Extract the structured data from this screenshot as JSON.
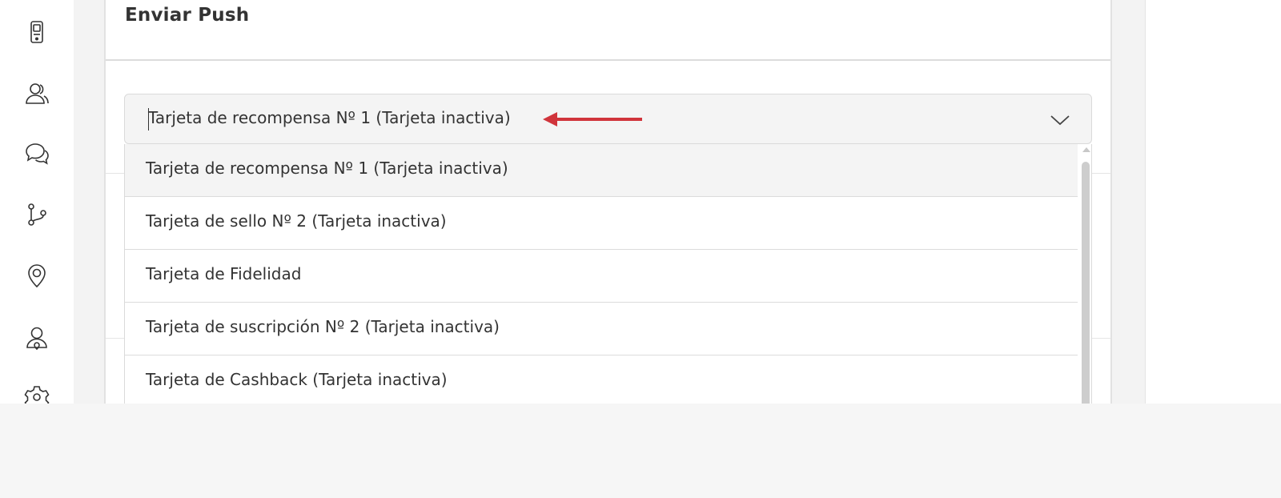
{
  "card": {
    "title": "Enviar Push"
  },
  "select": {
    "value": "Tarjeta de recompensa Nº 1 (Tarjeta inactiva)"
  },
  "dropdown": {
    "options": [
      "Tarjeta de recompensa Nº 1 (Tarjeta inactiva)",
      "Tarjeta de sello Nº 2 (Tarjeta inactiva)",
      "Tarjeta de Fidelidad",
      "Tarjeta de suscripción Nº 2 (Tarjeta inactiva)",
      "Tarjeta de Cashback (Tarjeta inactiva)"
    ],
    "selected_index": 0
  },
  "sidebar": {
    "icons": [
      "mobile-device-icon",
      "users-icon",
      "chat-icon",
      "flow-icon",
      "location-pin-icon",
      "user-location-icon",
      "settings-icon"
    ]
  },
  "colors": {
    "annotation_arrow": "#d0343b",
    "selected_option_bg": "#f4f4f4",
    "page_bg": "#f6f6f6"
  }
}
